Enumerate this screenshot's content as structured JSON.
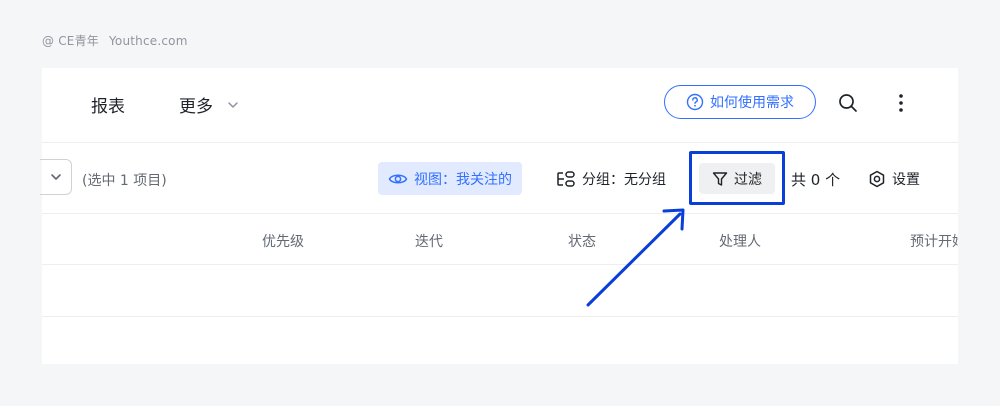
{
  "watermark": {
    "brand": "@ CE青年",
    "site": "Youthce.com"
  },
  "topbar": {
    "nav": [
      {
        "label": "报表"
      },
      {
        "label": "更多"
      }
    ],
    "help_label": "如何使用需求"
  },
  "toolbar": {
    "selected_text": "(选中 1 项目)",
    "view_label": "视图：我关注的",
    "group_label": "分组：无分组",
    "filter_label": "过滤",
    "count_label": "共 0 个",
    "settings_label": "设置"
  },
  "table": {
    "columns": [
      "优先级",
      "迭代",
      "状态",
      "处理人",
      "预计开始"
    ],
    "rows": []
  },
  "colors": {
    "accent": "#3370ff",
    "highlight": "#0a3ed8",
    "view_bg": "#e1eaff"
  },
  "icons": [
    "chevron-down-icon",
    "help-circle-icon",
    "search-icon",
    "more-vertical-icon",
    "eye-icon",
    "group-icon",
    "filter-icon",
    "settings-hexagon-icon"
  ]
}
